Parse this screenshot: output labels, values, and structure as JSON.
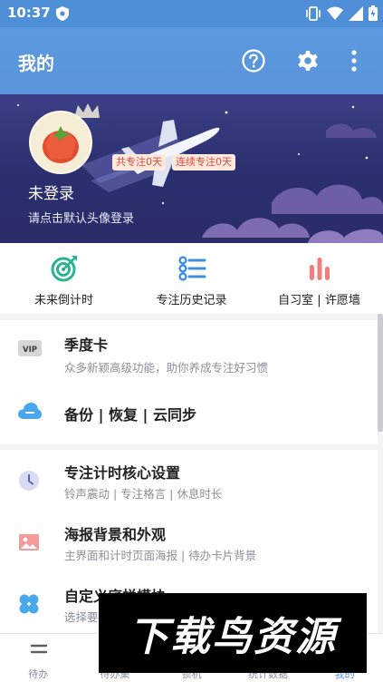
{
  "status_bar": {
    "time": "10:37"
  },
  "app_bar": {
    "title": "我的"
  },
  "profile": {
    "total_focus_tag": "共专注0天",
    "streak_tag": "连续专注0天",
    "username": "未登录",
    "hint": "请点击默认头像登录"
  },
  "quick_actions": [
    {
      "label": "未来倒计时",
      "icon": "target-icon"
    },
    {
      "label": "专注历史记录",
      "icon": "history-list-icon"
    },
    {
      "label": "自习室 | 许愿墙",
      "icon": "bar-stats-icon"
    }
  ],
  "membership": [
    {
      "title": "季度卡",
      "subtitle": "众多新颖高级功能，助你养成专注好习惯",
      "icon": "vip-icon",
      "badge": "VIP"
    },
    {
      "title": "备份 | 恢复 | 云同步",
      "subtitle": "",
      "icon": "cloud-icon"
    }
  ],
  "settings": [
    {
      "title": "专注计时核心设置",
      "subtitle": "铃声震动 | 专注格言 | 休息时长",
      "icon": "clock-icon"
    },
    {
      "title": "海报背景和外观",
      "subtitle": "主界面和计时页面海报 | 待办卡片背景",
      "icon": "image-icon"
    },
    {
      "title": "自定义底栏模块",
      "subtitle": "选择要",
      "icon": "clover-icon"
    }
  ],
  "bottom_nav": [
    {
      "label": "待办",
      "active": false
    },
    {
      "label": "待办集",
      "active": false
    },
    {
      "label": "锁机",
      "active": false
    },
    {
      "label": "统计数据",
      "active": false
    },
    {
      "label": "我的",
      "active": true
    }
  ],
  "watermark": {
    "text": "下载鸟资源"
  },
  "colors": {
    "primary": "#4f8fd8",
    "hero_bg": "#2b2e6d",
    "tag_text": "#e4473d",
    "tag_bg": "#ffe9dd"
  }
}
